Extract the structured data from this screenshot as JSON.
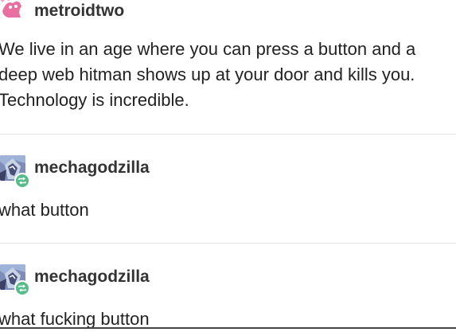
{
  "posts": [
    {
      "username": "metroidtwo",
      "avatar": "pink-character-avatar",
      "lines": [
        "We live in an age where you can press a button and a",
        "deep web hitman shows up at your door and kills you.",
        "Technology is incredible."
      ]
    },
    {
      "username": "mechagodzilla",
      "avatar": "mech-robot-avatar",
      "badge": "reblog-icon",
      "lines": [
        "what button"
      ]
    },
    {
      "username": "mechagodzilla",
      "avatar": "mech-robot-avatar",
      "badge": "reblog-icon",
      "lines": [
        "what fucking button"
      ]
    }
  ],
  "colors": {
    "text": "#222222",
    "username": "#333333",
    "divider": "#e3e3e3",
    "reblog_badge": "#56bc8a",
    "avatar_pink": "#e86fa0"
  }
}
